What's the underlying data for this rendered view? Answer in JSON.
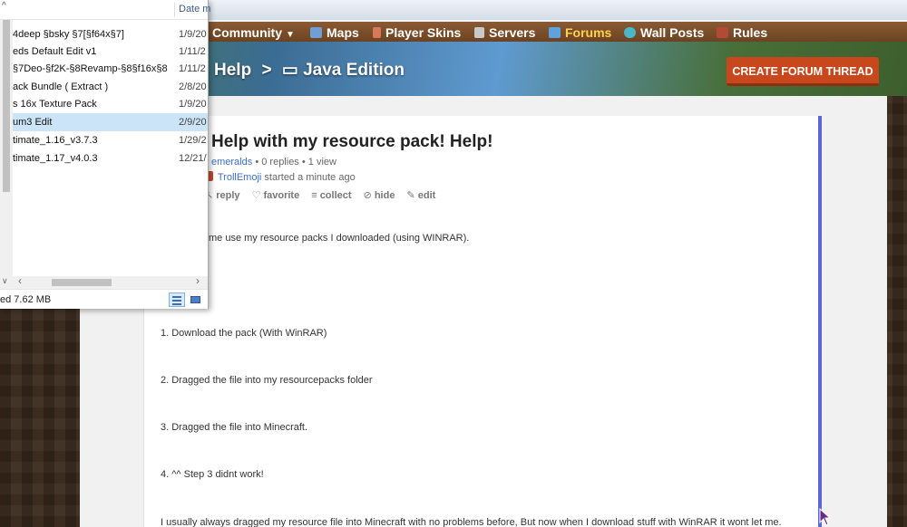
{
  "nav": {
    "items": [
      {
        "label": "Community",
        "dropdown": true
      },
      {
        "label": "Maps"
      },
      {
        "label": "Player Skins"
      },
      {
        "label": "Servers"
      },
      {
        "label": "Forums",
        "active": true
      },
      {
        "label": "Wall Posts"
      },
      {
        "label": "Rules"
      }
    ]
  },
  "breadcrumb": {
    "part1": "Help",
    "separator": ">",
    "part2": "Java Edition"
  },
  "create_button": "CREATE FORUM THREAD",
  "thread": {
    "title": "Help with my resource pack! Help!",
    "author_fragment": "emeralds",
    "replies": "0 replies",
    "views": "1 view",
    "starter_name": "TrollEmoji",
    "starter_text": "started a minute ago",
    "actions": {
      "reply": "reply",
      "favorite": "favorite",
      "collect": "collect",
      "hide": "hide",
      "edit": "edit"
    },
    "paragraphs": [
      "me use my resource packs I downloaded (using WINRAR).",
      "1. Download the pack (With WinRAR)",
      "2. Dragged the file into my resourcepacks folder",
      "3. Dragged the file into Minecraft.",
      "4. ^^ Step 3 didnt work!",
      "I usually always dragged my resource file into Minecraft with no problems before, But now when I download stuff with WinRAR it wont let me."
    ]
  },
  "explorer": {
    "column_date": "Date m",
    "files": [
      {
        "name": "4deep §bsky §7[§f64x§7]",
        "date": "1/9/20"
      },
      {
        "name": "eds Default Edit v1",
        "date": "1/11/2"
      },
      {
        "name": "§7Deo-§f2K-§8Revamp-§8§f16x§8",
        "date": "1/11/2"
      },
      {
        "name": "ack Bundle ( Extract )",
        "date": "2/8/20"
      },
      {
        "name": "s 16x Texture Pack",
        "date": "1/9/20"
      },
      {
        "name": "um3 Edit",
        "date": "2/9/20",
        "selected": true
      },
      {
        "name": "timate_1.16_v3.7.3",
        "date": "1/29/2"
      },
      {
        "name": "timate_1.17_v4.0.3",
        "date": "12/21/"
      }
    ],
    "status": "ed  7.62 MB"
  },
  "colors": {
    "accent_active": "#ffd24a",
    "create_button": "#c9471c",
    "link": "#3b6ec6",
    "thread_border": "#5a68d6"
  }
}
